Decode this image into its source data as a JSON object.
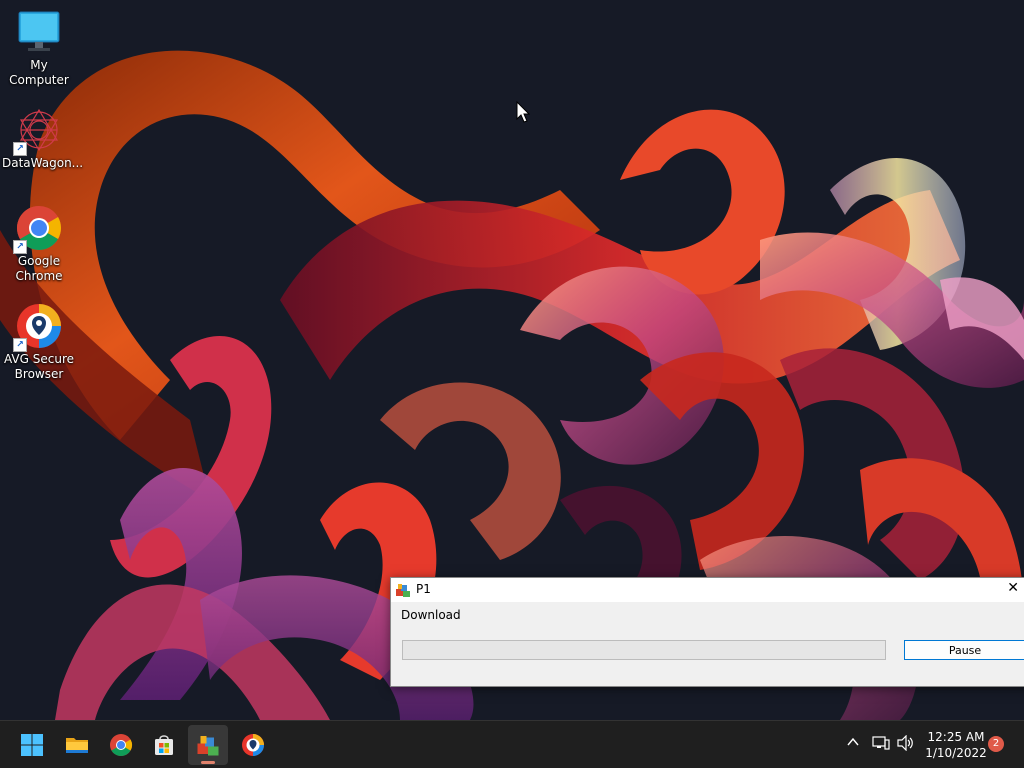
{
  "desktop": {
    "icons": [
      {
        "label": "My Computer",
        "icon": "monitor-icon"
      },
      {
        "label": "DataWagon...",
        "icon": "datawagon-icon"
      },
      {
        "label": "Google Chrome",
        "icon": "chrome-icon"
      },
      {
        "label": "AVG Secure Browser",
        "icon": "avg-browser-icon"
      }
    ]
  },
  "dialog": {
    "title": "P1",
    "label": "Download",
    "progress": 0,
    "pause_label": "Pause",
    "close_glyph": "✕"
  },
  "taskbar": {
    "apps": [
      {
        "name": "Start",
        "icon": "windows-start-icon"
      },
      {
        "name": "File Explorer",
        "icon": "folder-icon"
      },
      {
        "name": "Google Chrome",
        "icon": "chrome-icon"
      },
      {
        "name": "Microsoft Store",
        "icon": "store-icon"
      },
      {
        "name": "P1",
        "icon": "installer-app-icon",
        "active": true
      },
      {
        "name": "AVG Secure Browser",
        "icon": "avg-browser-icon"
      }
    ],
    "time": "12:25 AM",
    "date": "1/10/2022",
    "notification_count": "2"
  },
  "colors": {
    "accent": "#0078d4",
    "taskbar": "#1f1f1f",
    "progress_fill": "#06b025",
    "badge": "#e05a49"
  }
}
